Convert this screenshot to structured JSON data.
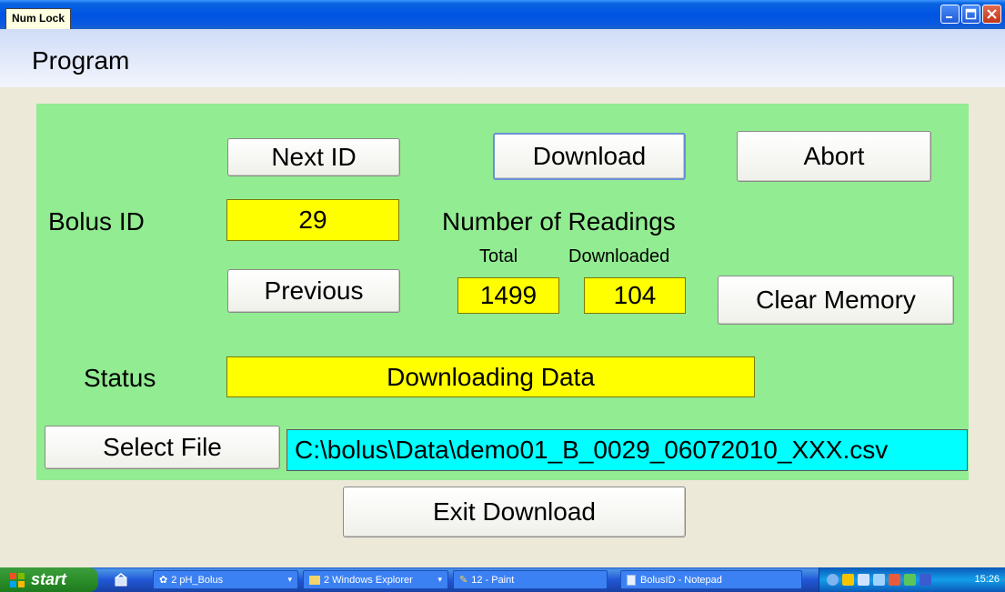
{
  "window": {
    "numlock_label": "Num Lock"
  },
  "menu": {
    "program": "Program"
  },
  "buttons": {
    "next_id": "Next ID",
    "download": "Download",
    "abort": "Abort",
    "previous": "Previous",
    "clear_memory": "Clear Memory",
    "select_file": "Select File",
    "exit_download": "Exit Download"
  },
  "labels": {
    "bolus_id": "Bolus ID",
    "number_of_readings": "Number of Readings",
    "total": "Total",
    "downloaded": "Downloaded",
    "status": "Status"
  },
  "values": {
    "bolus_id": "29",
    "total_readings": "1499",
    "downloaded_readings": "104",
    "status": "Downloading Data",
    "file_path": "C:\\bolus\\Data\\demo01_B_0029_06072010_XXX.csv"
  },
  "colors": {
    "panel": "#92ec91",
    "value_field": "#ffff00",
    "file_field": "#00ffff"
  },
  "taskbar": {
    "start": "start",
    "tasks": [
      {
        "label": "2 pH_Bolus",
        "icon": "app-icon"
      },
      {
        "label": "2 Windows Explorer",
        "icon": "folder-icon"
      },
      {
        "label": "12 - Paint",
        "icon": "paint-icon"
      },
      {
        "label": "BolusID - Notepad",
        "icon": "notepad-icon"
      }
    ],
    "clock": "15:26"
  }
}
